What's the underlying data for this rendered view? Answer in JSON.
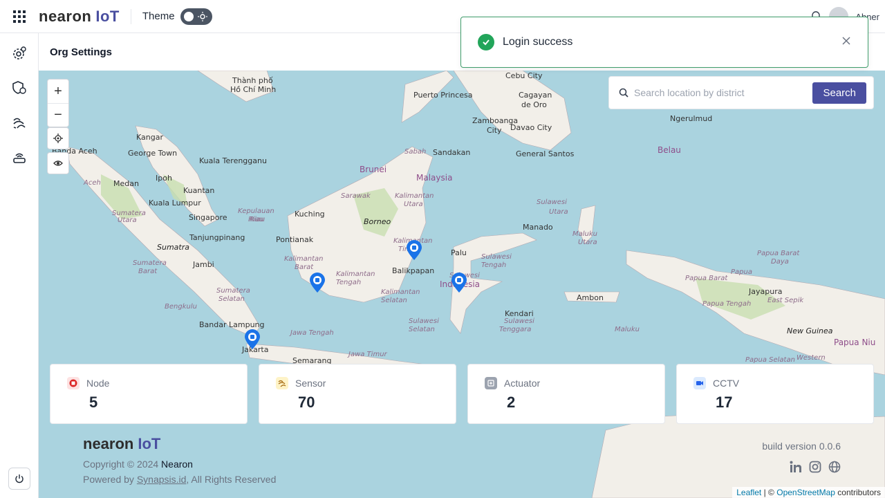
{
  "header": {
    "logo_main": "nearon",
    "logo_suffix": "IoT",
    "theme_label": "Theme",
    "username": "Abner"
  },
  "page": {
    "title": "Org Settings"
  },
  "toast": {
    "message": "Login success"
  },
  "map": {
    "search_placeholder": "Search location by district",
    "search_button": "Search",
    "places": [
      {
        "text": "Thành phố",
        "cls": ""
      },
      {
        "text": "Hồ Chí Minh",
        "cls": ""
      },
      {
        "text": "Puerto Princesa",
        "cls": ""
      },
      {
        "text": "Cebu City",
        "cls": ""
      },
      {
        "text": "Cagayan",
        "cls": ""
      },
      {
        "text": "de Oro",
        "cls": ""
      },
      {
        "text": "Zamboanga",
        "cls": ""
      },
      {
        "text": "City",
        "cls": ""
      },
      {
        "text": "Davao City",
        "cls": ""
      },
      {
        "text": "General Santos",
        "cls": ""
      },
      {
        "text": "Ngerulmud",
        "cls": ""
      },
      {
        "text": "Belau",
        "cls": "country"
      },
      {
        "text": "Kangar",
        "cls": ""
      },
      {
        "text": "Banda Aceh",
        "cls": ""
      },
      {
        "text": "George Town",
        "cls": ""
      },
      {
        "text": "Kuala Terengganu",
        "cls": ""
      },
      {
        "text": "Sabah",
        "cls": "region"
      },
      {
        "text": "Sandakan",
        "cls": ""
      },
      {
        "text": "Brunei",
        "cls": "country"
      },
      {
        "text": "Malaysia",
        "cls": "country"
      },
      {
        "text": "Aceh",
        "cls": "region"
      },
      {
        "text": "Medan",
        "cls": ""
      },
      {
        "text": "Ipoh",
        "cls": ""
      },
      {
        "text": "Kuantan",
        "cls": ""
      },
      {
        "text": "Sarawak",
        "cls": "region"
      },
      {
        "text": "Kalimantan",
        "cls": "region"
      },
      {
        "text": "Utara",
        "cls": "region"
      },
      {
        "text": "Kuala Lumpur",
        "cls": ""
      },
      {
        "text": "Sulawesi",
        "cls": "region"
      },
      {
        "text": "Utara",
        "cls": "region"
      },
      {
        "text": "Sumatera",
        "cls": "region"
      },
      {
        "text": "Utara",
        "cls": "region"
      },
      {
        "text": "Kepulauan",
        "cls": "region"
      },
      {
        "text": "Riau",
        "cls": "region"
      },
      {
        "text": "Kuching",
        "cls": ""
      },
      {
        "text": "Borneo",
        "cls": "island"
      },
      {
        "text": "Singapore",
        "cls": ""
      },
      {
        "text": "Riau",
        "cls": "region"
      },
      {
        "text": "Manado",
        "cls": ""
      },
      {
        "text": "Maluku",
        "cls": "region"
      },
      {
        "text": "Utara",
        "cls": "region"
      },
      {
        "text": "Tanjungpinang",
        "cls": ""
      },
      {
        "text": "Pontianak",
        "cls": ""
      },
      {
        "text": "Kalimantan",
        "cls": "region"
      },
      {
        "text": "Timur",
        "cls": "region"
      },
      {
        "text": "Sumatra",
        "cls": "island"
      },
      {
        "text": "Palu",
        "cls": ""
      },
      {
        "text": "Papua Barat",
        "cls": "region"
      },
      {
        "text": "Daya",
        "cls": "region"
      },
      {
        "text": "Kalimantan",
        "cls": "region"
      },
      {
        "text": "Barat",
        "cls": "region"
      },
      {
        "text": "Sulawesi",
        "cls": "region"
      },
      {
        "text": "Tengah",
        "cls": "region"
      },
      {
        "text": "Balikpapan",
        "cls": ""
      },
      {
        "text": "Jambi",
        "cls": ""
      },
      {
        "text": "Papua",
        "cls": "region"
      },
      {
        "text": "Papua Barat",
        "cls": "region"
      },
      {
        "text": "Sumatera",
        "cls": "region"
      },
      {
        "text": "Barat",
        "cls": "region"
      },
      {
        "text": "Kalimantan",
        "cls": "region"
      },
      {
        "text": "Tengah",
        "cls": "region"
      },
      {
        "text": "Sulawesi",
        "cls": "region"
      },
      {
        "text": "Indonesia",
        "cls": "country"
      },
      {
        "text": "Jayapura",
        "cls": ""
      },
      {
        "text": "Ambon",
        "cls": ""
      },
      {
        "text": "Sumatera",
        "cls": "region"
      },
      {
        "text": "Selatan",
        "cls": "region"
      },
      {
        "text": "Kalimantan",
        "cls": "region"
      },
      {
        "text": "Selatan",
        "cls": "region"
      },
      {
        "text": "Papua Tengah",
        "cls": "region"
      },
      {
        "text": "East Sepik",
        "cls": "region"
      },
      {
        "text": "Bengkulu",
        "cls": "region"
      },
      {
        "text": "Kendari",
        "cls": ""
      },
      {
        "text": "Sulawesi",
        "cls": "region"
      },
      {
        "text": "Selatan",
        "cls": "region"
      },
      {
        "text": "Sulawesi",
        "cls": "region"
      },
      {
        "text": "Tenggara",
        "cls": "region"
      },
      {
        "text": "Bandar Lampung",
        "cls": ""
      },
      {
        "text": "Maluku",
        "cls": "region"
      },
      {
        "text": "New Guinea",
        "cls": "island"
      },
      {
        "text": "Papua Niu",
        "cls": "country"
      },
      {
        "text": "Jawa Tengah",
        "cls": "region"
      },
      {
        "text": "Jakarta",
        "cls": ""
      },
      {
        "text": "Jawa Timur",
        "cls": "region"
      },
      {
        "text": "Semarang",
        "cls": ""
      },
      {
        "text": "Papua Selatan",
        "cls": "region"
      },
      {
        "text": "Western",
        "cls": "region"
      }
    ]
  },
  "stats": [
    {
      "label": "Node",
      "value": "5",
      "icon": "node-icon",
      "color": "#dc2626",
      "bg": "#fde2e2"
    },
    {
      "label": "Sensor",
      "value": "70",
      "icon": "sensor-icon",
      "color": "#a16207",
      "bg": "#fef3c7"
    },
    {
      "label": "Actuator",
      "value": "2",
      "icon": "actuator-icon",
      "color": "#6b7280",
      "bg": "#e5e7eb"
    },
    {
      "label": "CCTV",
      "value": "17",
      "icon": "cctv-icon",
      "color": "#2563eb",
      "bg": "#dbeafe"
    }
  ],
  "footer": {
    "logo_main": "nearon",
    "logo_suffix": "IoT",
    "copyright_prefix": "Copyright © 2024",
    "copyright_brand": "Nearon",
    "powered_prefix": "Powered by",
    "powered_link": "Synapsis.id",
    "powered_suffix": ", All Rights Reserved",
    "build": "build version 0.0.6"
  },
  "attribution": {
    "leaflet": "Leaflet",
    "sep": "| ©",
    "osm": "OpenStreetMap",
    "contrib": "contributors"
  },
  "colors": {
    "accent": "#4a4fa0",
    "success": "#22a55a",
    "marker": "#1a73e8",
    "sea": "#aad3df",
    "land": "#f2efe9"
  }
}
